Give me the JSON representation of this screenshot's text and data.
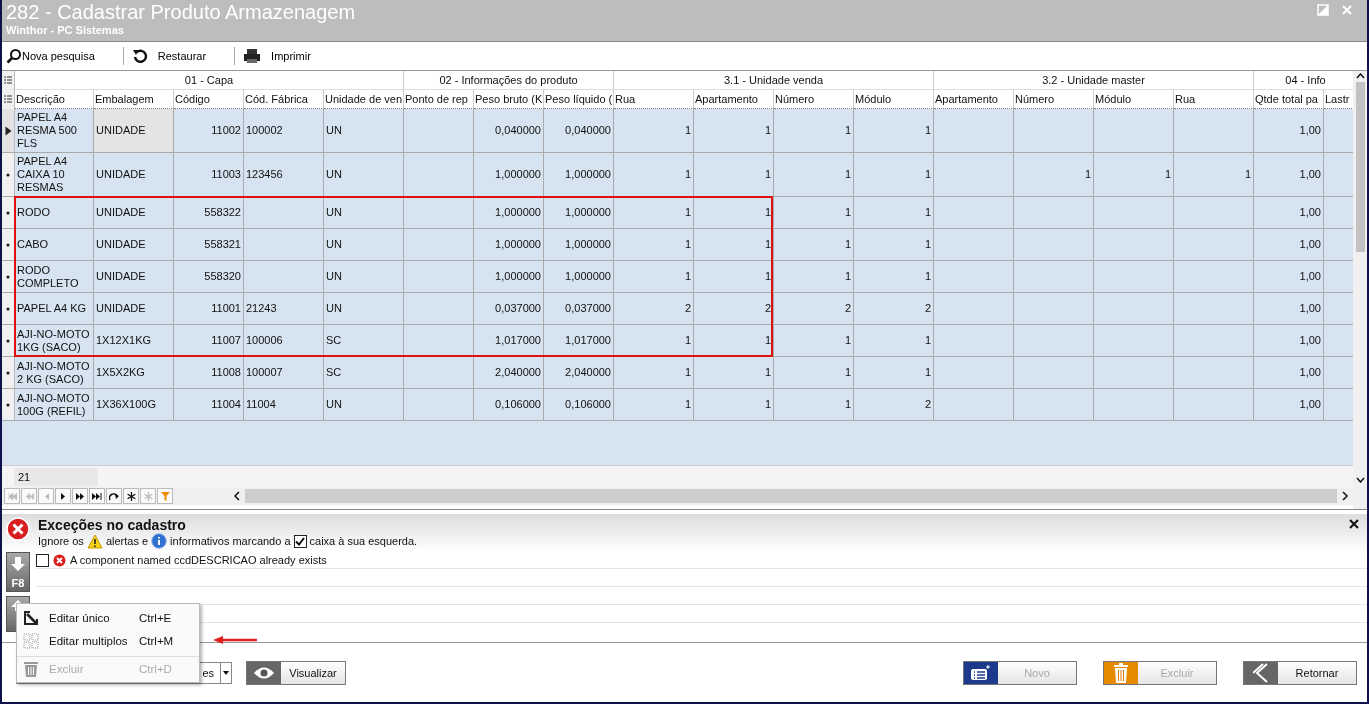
{
  "window": {
    "title": "282 - Cadastrar Produto Armazenagem",
    "subtitle": "Winthor - PC Sistemas"
  },
  "toolbar": [
    {
      "label": "Nova pesquisa",
      "kind": "search"
    },
    {
      "label": "Restaurar",
      "kind": "restore"
    },
    {
      "label": "Imprimir",
      "kind": "print"
    }
  ],
  "grid": {
    "groups": [
      {
        "label": "01 - Capa",
        "columns": [
          "Descrição",
          "Embalagem",
          "Código",
          "Cód. Fábrica",
          "Unidade de ven"
        ]
      },
      {
        "label": "02 - Informações do produto",
        "columns": [
          "Ponto de rep",
          "Peso bruto (K",
          "Peso líquido ("
        ]
      },
      {
        "label": "3.1 - Unidade venda",
        "columns": [
          "Rua",
          "Apartamento",
          "Número",
          "Módulo"
        ]
      },
      {
        "label": "3.2 - Unidade master",
        "columns": [
          "Apartamento",
          "Número",
          "Módulo",
          "Rua"
        ]
      },
      {
        "label": "04 - Info",
        "columns": [
          "Qtde total pa",
          "Lastr"
        ]
      }
    ],
    "rows": [
      {
        "current": true,
        "highlighted": false,
        "cells": [
          "PAPEL A4 RESMA 500 FLS",
          "UNIDADE",
          "11002",
          "100002",
          "UN",
          "",
          "0,040000",
          "0,040000",
          "1",
          "1",
          "1",
          "1",
          "",
          "",
          "",
          "",
          "1,00",
          ""
        ]
      },
      {
        "current": false,
        "highlighted": false,
        "cells": [
          "PAPEL A4 CAIXA 10 RESMAS",
          "UNIDADE",
          "11003",
          "123456",
          "UN",
          "",
          "1,000000",
          "1,000000",
          "1",
          "1",
          "1",
          "1",
          "",
          "1",
          "1",
          "1",
          "1,00",
          ""
        ]
      },
      {
        "current": false,
        "highlighted": true,
        "cells": [
          "RODO",
          "UNIDADE",
          "558322",
          "",
          "UN",
          "",
          "1,000000",
          "1,000000",
          "1",
          "1",
          "1",
          "1",
          "",
          "",
          "",
          "",
          "1,00",
          ""
        ]
      },
      {
        "current": false,
        "highlighted": true,
        "cells": [
          "CABO",
          "UNIDADE",
          "558321",
          "",
          "UN",
          "",
          "1,000000",
          "1,000000",
          "1",
          "1",
          "1",
          "1",
          "",
          "",
          "",
          "",
          "1,00",
          ""
        ]
      },
      {
        "current": false,
        "highlighted": true,
        "cells": [
          "RODO COMPLETO",
          "UNIDADE",
          "558320",
          "",
          "UN",
          "",
          "1,000000",
          "1,000000",
          "1",
          "1",
          "1",
          "1",
          "",
          "",
          "",
          "",
          "1,00",
          ""
        ]
      },
      {
        "current": false,
        "highlighted": true,
        "cells": [
          "PAPEL A4 KG",
          "UNIDADE",
          "11001",
          "21243",
          "UN",
          "",
          "0,037000",
          "0,037000",
          "2",
          "2",
          "2",
          "2",
          "",
          "",
          "",
          "",
          "1,00",
          ""
        ]
      },
      {
        "current": false,
        "highlighted": true,
        "cells": [
          "AJI-NO-MOTO 1KG (SACO)",
          "1X12X1KG",
          "11007",
          "100006",
          "SC",
          "",
          "1,017000",
          "1,017000",
          "1",
          "1",
          "1",
          "1",
          "",
          "",
          "",
          "",
          "1,00",
          ""
        ]
      },
      {
        "current": false,
        "highlighted": false,
        "cells": [
          "AJI-NO-MOTO 2 KG (SACO)",
          "1X5X2KG",
          "11008",
          "100007",
          "SC",
          "",
          "2,040000",
          "2,040000",
          "1",
          "1",
          "1",
          "1",
          "",
          "",
          "",
          "",
          "1,00",
          ""
        ]
      },
      {
        "current": false,
        "highlighted": false,
        "cells": [
          "AJI-NO-MOTO 100G (REFIL)",
          "1X36X100G",
          "11004",
          "11004",
          "UN",
          "",
          "0,106000",
          "0,106000",
          "1",
          "1",
          "1",
          "2",
          "",
          "",
          "",
          "",
          "1,00",
          ""
        ]
      }
    ],
    "record_count": "21"
  },
  "exceptions": {
    "title": "Exceções no cadastro",
    "hint": [
      {
        "kind": "text",
        "text": "Ignore os"
      },
      {
        "kind": "warning"
      },
      {
        "kind": "text",
        "text": "alertas e"
      },
      {
        "kind": "info"
      },
      {
        "kind": "text",
        "text": "informativos marcando a"
      },
      {
        "kind": "checkbox",
        "checked": true
      },
      {
        "kind": "text",
        "text": "caixa à sua esquerda."
      }
    ],
    "items": [
      {
        "checked": false,
        "text": "A component named ccdDESCRICAO already exists"
      }
    ],
    "side_label": "F8"
  },
  "context_menu": [
    {
      "kind": "edit",
      "label": "Editar único",
      "shortcut": "Ctrl+E",
      "disabled": false,
      "annotated": false
    },
    {
      "kind": "multi",
      "label": "Editar multiplos",
      "shortcut": "Ctrl+M",
      "disabled": false,
      "annotated": true
    },
    {
      "kind": "delete",
      "label": "Excluir",
      "shortcut": "Ctrl+D",
      "disabled": true,
      "annotated": false
    }
  ],
  "bottom": {
    "dropdown": {
      "value": "es"
    },
    "view_button": {
      "label": "Visualizar"
    },
    "buttons": [
      {
        "kind": "new",
        "label": "Novo",
        "disabled": true
      },
      {
        "kind": "delete",
        "label": "Excluir",
        "disabled": true
      },
      {
        "kind": "back",
        "label": "Retornar",
        "disabled": false
      }
    ]
  }
}
